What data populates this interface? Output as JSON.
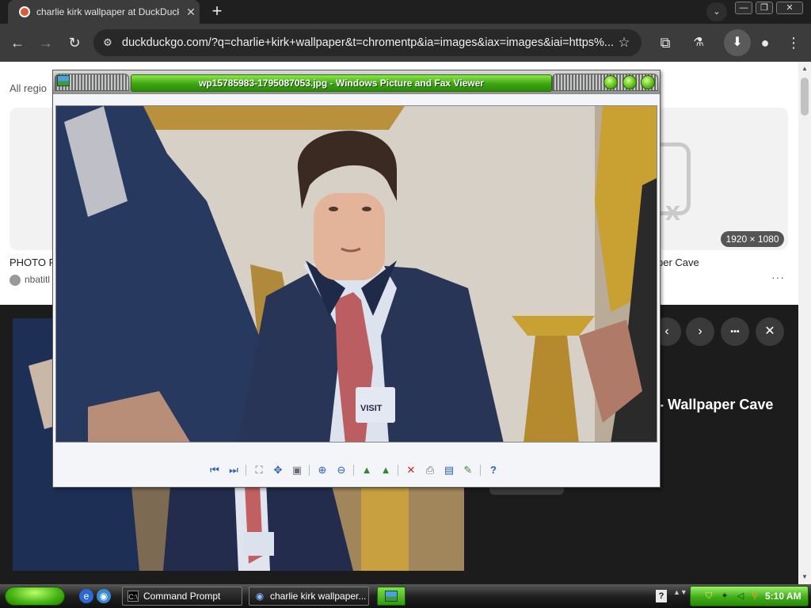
{
  "browser": {
    "tab": {
      "title": "charlie kirk wallpaper at DuckDuckGo"
    },
    "window_controls": {
      "minimize": "—",
      "restore": "❐",
      "close": "✕"
    },
    "toolbar": {
      "back": "←",
      "forward": "→",
      "reload": "↻",
      "url": "duckduckgo.com/?q=charlie+kirk+wallpaper&t=chromentp&ia=images&iax=images&iai=https%...",
      "bookmark": "☆",
      "extensions": "⧉",
      "labs": "⚗",
      "download": "⬇",
      "profile": "●",
      "menu": "⋮"
    }
  },
  "page": {
    "regions_label": "All regio",
    "result_left": {
      "title": "PHOTO R",
      "source": "nbatitl"
    },
    "result_right": {
      "title": "per Cave",
      "size_badge": "1920 × 1080",
      "more": "···"
    },
    "detail": {
      "title": "- Wallpaper Cave",
      "prev": "‹",
      "next": "›",
      "more": "•••",
      "close": "✕"
    }
  },
  "viewer": {
    "title": "wp15785983-1795087053.jpg - Windows Picture and Fax Viewer",
    "tools": [
      {
        "name": "previous-image",
        "glyph": "⏮"
      },
      {
        "name": "next-image",
        "glyph": "⏭"
      },
      {
        "name": "best-fit",
        "glyph": "⛶"
      },
      {
        "name": "actual-size",
        "glyph": "✥"
      },
      {
        "name": "slideshow",
        "glyph": "▣"
      },
      {
        "name": "zoom-in",
        "glyph": "⊕"
      },
      {
        "name": "zoom-out",
        "glyph": "⊖"
      },
      {
        "name": "rotate-clockwise",
        "glyph": "▲"
      },
      {
        "name": "rotate-counterclockwise",
        "glyph": "▲"
      },
      {
        "name": "delete",
        "glyph": "✕"
      },
      {
        "name": "print",
        "glyph": "⎙"
      },
      {
        "name": "save-copy",
        "glyph": "▤"
      },
      {
        "name": "open-for-editing",
        "glyph": "✎"
      },
      {
        "name": "help",
        "glyph": "?"
      }
    ]
  },
  "taskbar": {
    "tasks": [
      {
        "label": "Command Prompt",
        "icon": "C:\\"
      },
      {
        "label": "charlie kirk wallpaper...",
        "icon": "◉"
      }
    ],
    "clock": "5:10 AM",
    "help": "?",
    "expand": "▲▼"
  },
  "colors": {
    "chrome_dark": "#3c3c3c",
    "xp_title_green": "#3da412",
    "xp_tray_green": "#3fae18"
  }
}
